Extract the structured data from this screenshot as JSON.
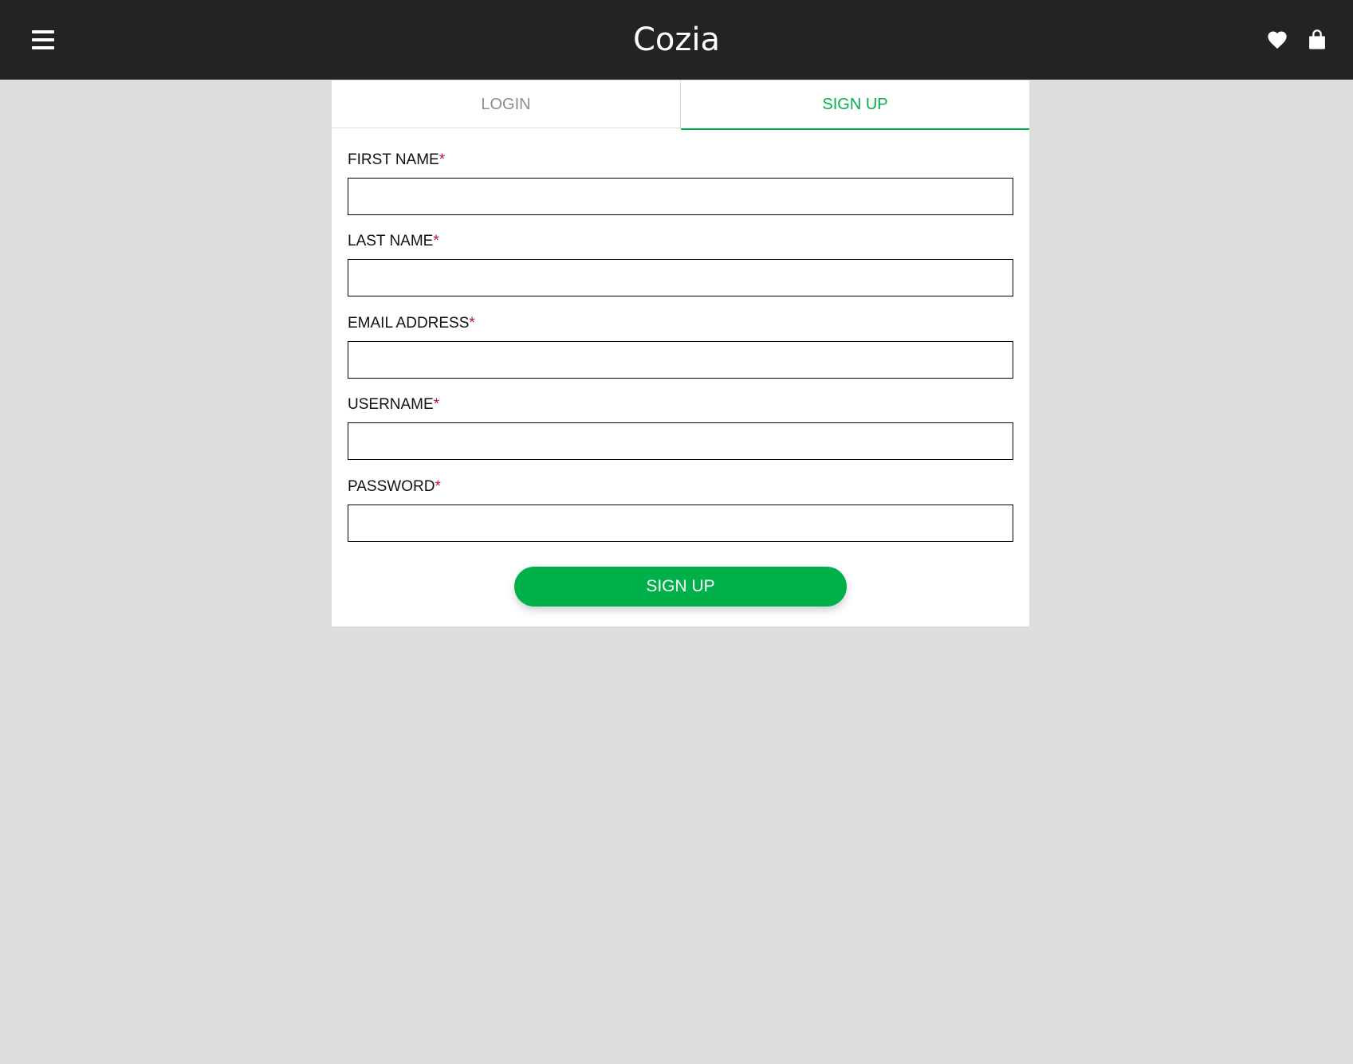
{
  "header": {
    "brand": "Cozia",
    "icons": [
      "menu-icon",
      "heart-icon",
      "shopping-bag-icon"
    ]
  },
  "auth": {
    "tabs": [
      {
        "label": "LOGIN",
        "active": false
      },
      {
        "label": "SIGN UP",
        "active": true
      }
    ],
    "fields": [
      {
        "label": "FIRST NAME",
        "required_mark": "*",
        "value": "",
        "placeholder": ""
      },
      {
        "label": "LAST NAME",
        "required_mark": "*",
        "value": "",
        "placeholder": ""
      },
      {
        "label": "EMAIL ADDRESS",
        "required_mark": "*",
        "value": "",
        "placeholder": ""
      },
      {
        "label": "USERNAME",
        "required_mark": "*",
        "value": "",
        "placeholder": ""
      },
      {
        "label": "PASSWORD",
        "required_mark": "*",
        "value": "",
        "placeholder": ""
      }
    ],
    "submit_label": "SIGN UP"
  },
  "colors": {
    "header_bg": "#232323",
    "page_bg": "#dddddd",
    "accent": "#00b14a",
    "required": "#c8102e",
    "inactive_tab": "#8c8c8c"
  }
}
